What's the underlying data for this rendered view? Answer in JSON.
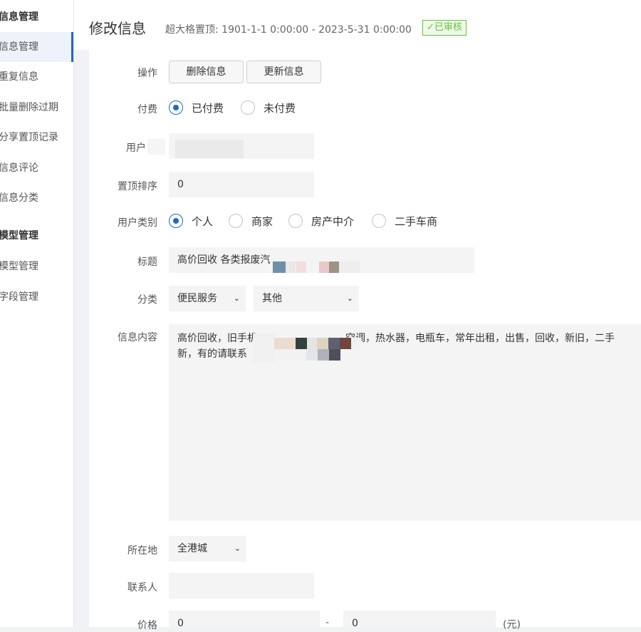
{
  "sidebar": {
    "group1": "信息管理",
    "items1": [
      "信息管理",
      "重复信息",
      "批量删除过期",
      "分享置顶记录",
      "信息评论",
      "信息分类"
    ],
    "group2": "模型管理",
    "items2": [
      "模型管理",
      "字段管理"
    ]
  },
  "header": {
    "title": "修改信息",
    "top_label": "超大格置顶:",
    "top_range": "1901-1-1 0:00:00 - 2023-5-31 0:00:00",
    "status": "已审核"
  },
  "form": {
    "op_label": "操作",
    "delete_btn": "删除信息",
    "update_btn": "更新信息",
    "pay_label": "付费",
    "pay_options": [
      "已付费",
      "未付费"
    ],
    "user_label": "用户",
    "pin_label": "置顶排序",
    "pin_value": "0",
    "usertype_label": "用户类别",
    "usertype_options": [
      "个人",
      "商家",
      "房产中介",
      "二手车商"
    ],
    "title_label": "标题",
    "title_value": "高价回收 各类报废汽",
    "category_label": "分类",
    "category_main": "便民服务",
    "category_sub": "其他",
    "content_label": "信息内容",
    "content_line1a": "高价回收，旧手机",
    "content_line1b": "空调，热水器，电瓶车，常年出租，出售，回收，新旧，二手",
    "content_line2": "新，有的请联系",
    "location_label": "所在地",
    "location_value": "全港城",
    "contact_label": "联系人",
    "price_label": "价格",
    "price_min": "0",
    "price_sep": "-",
    "price_max": "0",
    "price_unit": "(元)"
  },
  "colors": {
    "accent": "#1e68c8",
    "status": "#67c23a"
  }
}
